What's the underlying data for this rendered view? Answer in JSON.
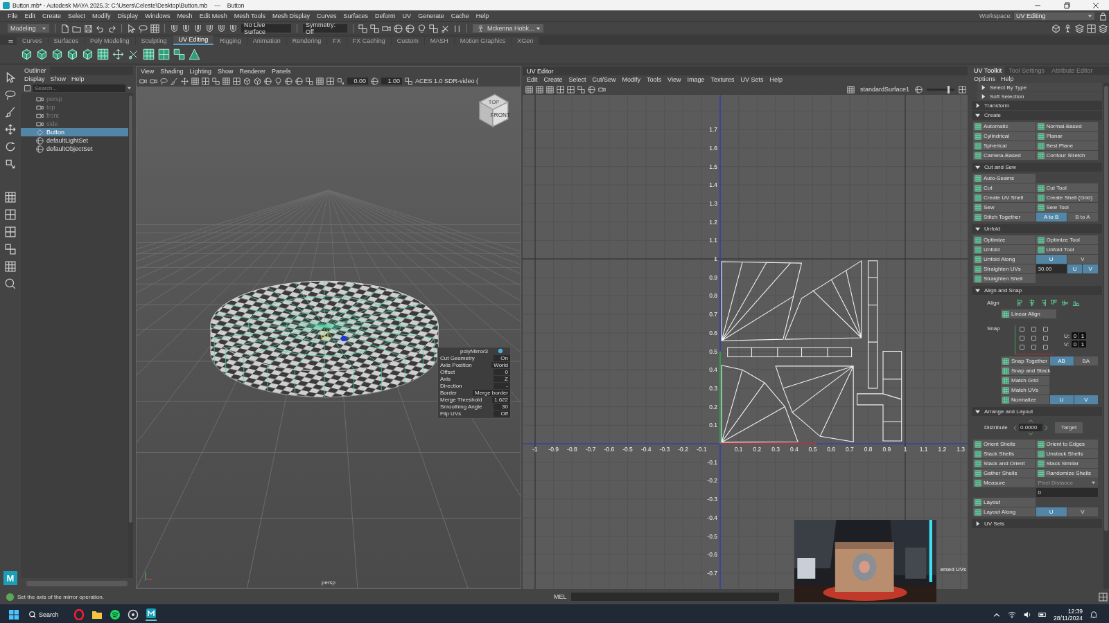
{
  "title_bar": {
    "title": "Button.mb* - Autodesk MAYA 2025.3: C:\\Users\\Celeste\\Desktop\\Button.mb",
    "separator": "---",
    "scene": "Button"
  },
  "menu_bar": [
    "File",
    "Edit",
    "Create",
    "Select",
    "Modify",
    "Display",
    "Windows",
    "Mesh",
    "Edit Mesh",
    "Mesh Tools",
    "Mesh Display",
    "Curves",
    "Surfaces",
    "Deform",
    "UV",
    "Generate",
    "Cache",
    "Help"
  ],
  "workspace": {
    "label": "Workspace:",
    "value": "UV Editing"
  },
  "status_line": {
    "mode": "Modeling",
    "live_surface": "No Live Surface",
    "symmetry": "Symmetry: Off",
    "user": "Mckenna Hobk..."
  },
  "shelf_tabs": [
    {
      "label": "Curves",
      "selected": false
    },
    {
      "label": "Surfaces",
      "selected": false
    },
    {
      "label": "Poly Modeling",
      "selected": false
    },
    {
      "label": "Sculpting",
      "selected": false
    },
    {
      "label": "UV Editing",
      "selected": true
    },
    {
      "label": "Rigging",
      "selected": false
    },
    {
      "label": "Animation",
      "selected": false
    },
    {
      "label": "Rendering",
      "selected": false
    },
    {
      "label": "FX",
      "selected": false
    },
    {
      "label": "FX Caching",
      "selected": false
    },
    {
      "label": "Custom",
      "selected": false
    },
    {
      "label": "MASH",
      "selected": false
    },
    {
      "label": "Motion Graphics",
      "selected": false
    },
    {
      "label": "XGen",
      "selected": false
    }
  ],
  "toolbox": {
    "logo": "M"
  },
  "outliner": {
    "tab": "Outliner",
    "menu": [
      "Display",
      "Show",
      "Help"
    ],
    "search": {
      "placeholder": "Search..."
    },
    "items": [
      {
        "label": "persp",
        "kind": "camera",
        "dimmed": true,
        "selected": false
      },
      {
        "label": "top",
        "kind": "camera",
        "dimmed": true,
        "selected": false
      },
      {
        "label": "front",
        "kind": "camera",
        "dimmed": true,
        "selected": false
      },
      {
        "label": "side",
        "kind": "camera",
        "dimmed": true,
        "selected": false
      },
      {
        "label": "Button",
        "kind": "mesh",
        "dimmed": false,
        "selected": true
      },
      {
        "label": "defaultLightSet",
        "kind": "set",
        "dimmed": false,
        "selected": false
      },
      {
        "label": "defaultObjectSet",
        "kind": "set",
        "dimmed": false,
        "selected": false
      }
    ]
  },
  "viewport": {
    "menu": [
      "View",
      "Shading",
      "Lighting",
      "Show",
      "Renderer",
      "Panels"
    ],
    "exposure": "0.00",
    "gamma": "1.00",
    "color_space": "ACES 1.0 SDR-video (",
    "view_cube": {
      "top": "TOP",
      "front": "FRONT"
    },
    "camera_label": "persp",
    "channel_box": {
      "title": "polyMirror3",
      "attributes": [
        {
          "name": "Cut Geometry",
          "value": "On"
        },
        {
          "name": "Axis Position",
          "value": "World"
        },
        {
          "name": "Offset",
          "value": "0"
        },
        {
          "name": "Axis",
          "value": "Z"
        },
        {
          "name": "Direction",
          "value": "-"
        },
        {
          "name": "Border",
          "value": "Merge border"
        },
        {
          "name": "Merge Threshold",
          "value": "1.622"
        },
        {
          "name": "Smoothing Angle",
          "value": "30"
        },
        {
          "name": "Flip UVs",
          "value": "Off"
        }
      ]
    }
  },
  "uv_editor": {
    "title": "UV Editor",
    "menu": [
      "Edit",
      "Create",
      "Select",
      "Cut/Sew",
      "Modify",
      "Tools",
      "View",
      "Image",
      "Textures",
      "UV Sets",
      "Help"
    ],
    "material": "standardSurface1",
    "u_ticks": [
      "-1",
      "-0.9",
      "-0.8",
      "-0.7",
      "-0.6",
      "-0.5",
      "-0.4",
      "-0.3",
      "-0.2",
      "-0.1",
      "0.1",
      "0.2",
      "0.3",
      "0.4",
      "0.5",
      "0.6",
      "0.7",
      "0.8",
      "0.9",
      "1",
      "1.1",
      "1.2",
      "1.3"
    ],
    "v_ticks": [
      "1.7",
      "1.6",
      "1.5",
      "1.4",
      "1.3",
      "1.2",
      "1.1",
      "1",
      "0.9",
      "0.8",
      "0.7",
      "0.6",
      "0.5",
      "0.4",
      "0.3",
      "0.2",
      "0.1",
      "-0.1",
      "-0.2",
      "-0.3",
      "-0.4",
      "-0.5",
      "-0.6",
      "-0.7"
    ],
    "overlay_text": "ersed UVs",
    "slider": {
      "level": 0.8
    }
  },
  "uv_toolkit": {
    "tabs": [
      {
        "label": "UV Toolkit",
        "selected": true
      },
      {
        "label": "Tool Settings",
        "selected": false
      },
      {
        "label": "Attribute Editor",
        "selected": false
      }
    ],
    "menu": [
      "Options",
      "Help"
    ],
    "sections": [
      {
        "title": "Select By Type",
        "kind": "sub",
        "expanded": false
      },
      {
        "title": "Soft Selection",
        "kind": "sub",
        "expanded": false
      },
      {
        "title": "Transform",
        "kind": "plain",
        "expanded": false
      },
      {
        "title": "Create",
        "kind": "buttons",
        "expanded": true,
        "rows": [
          [
            {
              "kind": "button",
              "label": "Automatic"
            },
            {
              "kind": "button",
              "label": "Normal-Based"
            }
          ],
          [
            {
              "kind": "button",
              "label": "Cylindrical"
            },
            {
              "kind": "button",
              "label": "Planar"
            }
          ],
          [
            {
              "kind": "button",
              "label": "Spherical"
            },
            {
              "kind": "button",
              "label": "Best Plane"
            }
          ],
          [
            {
              "kind": "button",
              "label": "Camera-Based"
            },
            {
              "kind": "button",
              "label": "Contour Stretch"
            }
          ]
        ]
      },
      {
        "title": "Cut and Sew",
        "kind": "buttons",
        "expanded": true,
        "rows": [
          [
            {
              "kind": "button",
              "label": "Auto-Seams"
            }
          ],
          [
            {
              "kind": "button",
              "label": "Cut"
            },
            {
              "kind": "button",
              "label": "Cut Tool"
            }
          ],
          [
            {
              "kind": "button",
              "label": "Create UV Shell"
            },
            {
              "kind": "button",
              "label": "Create Shell (Grid)"
            }
          ],
          [
            {
              "kind": "button",
              "label": "Sew"
            },
            {
              "kind": "button",
              "label": "Sew Tool"
            }
          ],
          [
            {
              "kind": "button",
              "label": "Stitch Together"
            },
            {
              "kind": "toggle",
              "label": "A to B",
              "selected": true
            },
            {
              "kind": "toggle",
              "label": "B to A",
              "selected": false
            }
          ]
        ]
      },
      {
        "title": "Unfold",
        "kind": "buttons",
        "expanded": true,
        "rows": [
          [
            {
              "kind": "button",
              "label": "Optimize"
            },
            {
              "kind": "button",
              "label": "Optimize Tool"
            }
          ],
          [
            {
              "kind": "button",
              "label": "Unfold"
            },
            {
              "kind": "button",
              "label": "Unfold Tool"
            }
          ],
          [
            {
              "kind": "button",
              "label": "Unfold Along"
            },
            {
              "kind": "toggle",
              "label": "U",
              "selected": true
            },
            {
              "kind": "toggle",
              "label": "V",
              "selected": false
            }
          ],
          [
            {
              "kind": "button",
              "label": "Straighten UVs"
            },
            {
              "kind": "field",
              "value": "30.00"
            },
            {
              "kind": "toggle",
              "label": "U",
              "selected": true
            },
            {
              "kind": "toggle",
              "label": "V",
              "selected": true
            }
          ],
          [
            {
              "kind": "button",
              "label": "Straighten Shell"
            }
          ]
        ]
      },
      {
        "title": "Align and Snap",
        "kind": "align_snap",
        "expanded": true,
        "align": {
          "label": "Align",
          "linear": "Linear Align"
        },
        "snap": {
          "label": "Snap",
          "checkboxes": [
            {
              "checked": false
            },
            {
              "checked": false
            },
            {
              "checked": false
            },
            {
              "checked": false
            },
            {
              "checked": false
            },
            {
              "checked": false
            },
            {
              "checked": false
            },
            {
              "checked": false
            },
            {
              "checked": false
            }
          ],
          "u": {
            "label": "U:",
            "values": [
              "0",
              "1"
            ]
          },
          "v": {
            "label": "V:",
            "values": [
              "0",
              "1"
            ]
          }
        },
        "rows": [
          [
            {
              "kind": "button",
              "label": "Snap Together"
            },
            {
              "kind": "toggle",
              "label": "AB",
              "selected": true
            },
            {
              "kind": "toggle",
              "label": "BA",
              "selected": false
            }
          ],
          [
            {
              "kind": "button",
              "label": "Snap and Stack"
            }
          ],
          [
            {
              "kind": "button",
              "label": "Match Grid"
            }
          ],
          [
            {
              "kind": "button",
              "label": "Match UVs"
            }
          ],
          [
            {
              "kind": "button",
              "label": "Normalize"
            },
            {
              "kind": "toggle",
              "label": "U",
              "selected": true
            },
            {
              "kind": "toggle",
              "label": "V",
              "selected": true
            }
          ]
        ]
      },
      {
        "title": "Arrange and Layout",
        "kind": "arrange",
        "expanded": true,
        "distribute": {
          "label": "Distribute",
          "value": "0.0000",
          "button": "Target"
        },
        "rows": [
          [
            {
              "kind": "button",
              "label": "Orient Shells"
            },
            {
              "kind": "button",
              "label": "Orient to Edges"
            }
          ],
          [
            {
              "kind": "button",
              "label": "Stack Shells"
            },
            {
              "kind": "button",
              "label": "Unstack Shells"
            }
          ],
          [
            {
              "kind": "button",
              "label": "Stack and Orient"
            },
            {
              "kind": "button",
              "label": "Stack Similar"
            }
          ],
          [
            {
              "kind": "button",
              "label": "Gather Shells"
            },
            {
              "kind": "button",
              "label": "Randomize Shells"
            }
          ],
          [
            {
              "kind": "button",
              "label": "Measure"
            },
            {
              "kind": "dropdown",
              "value": "Pixel Distance"
            }
          ],
          [
            {
              "kind": "field",
              "value": "0"
            }
          ],
          [
            {
              "kind": "button",
              "label": "Layout"
            }
          ],
          [
            {
              "kind": "button",
              "label": "Layout Along"
            },
            {
              "kind": "toggle",
              "label": "U",
              "selected": true
            },
            {
              "kind": "toggle",
              "label": "V",
              "selected": false
            }
          ]
        ]
      },
      {
        "title": "UV Sets",
        "kind": "plain",
        "expanded": false
      }
    ]
  },
  "help_line": "Set the axis of the mirror operation.",
  "command_line": {
    "language": "MEL"
  },
  "taskbar": {
    "search": "Search",
    "time": "12:39",
    "date": "28/11/2024"
  }
}
